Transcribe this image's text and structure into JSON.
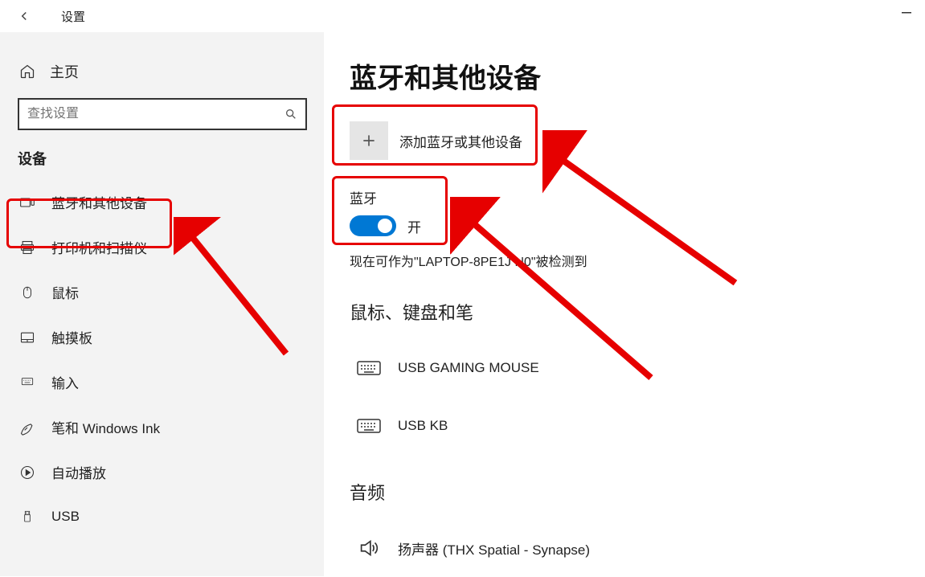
{
  "window": {
    "title": "设置"
  },
  "sidebar": {
    "home_label": "主页",
    "search_placeholder": "查找设置",
    "section_label": "设备",
    "items": [
      {
        "label": "蓝牙和其他设备"
      },
      {
        "label": "打印机和扫描仪"
      },
      {
        "label": "鼠标"
      },
      {
        "label": "触摸板"
      },
      {
        "label": "输入"
      },
      {
        "label": "笔和 Windows Ink"
      },
      {
        "label": "自动播放"
      },
      {
        "label": "USB"
      }
    ]
  },
  "main": {
    "page_title": "蓝牙和其他设备",
    "add_device_label": "添加蓝牙或其他设备",
    "bluetooth_header": "蓝牙",
    "toggle_state_label": "开",
    "detected_text": "现在可作为\"LAPTOP-8PE1J  N0\"被检测到",
    "section_mouse_kb": "鼠标、键盘和笔",
    "devices_mouse_kb": [
      {
        "label": "USB GAMING MOUSE"
      },
      {
        "label": "USB KB"
      }
    ],
    "section_audio": "音频",
    "devices_audio": [
      {
        "label": "扬声器 (THX Spatial - Synapse)"
      }
    ]
  },
  "colors": {
    "accent": "#0078d4",
    "annotation": "#e60000"
  }
}
